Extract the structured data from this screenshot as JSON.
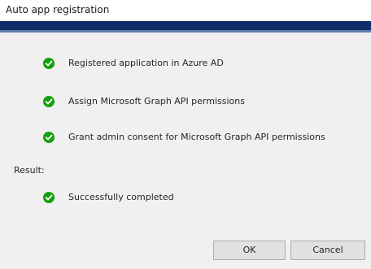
{
  "window": {
    "title": "Auto app registration"
  },
  "steps": [
    {
      "label": "Registered application in Azure AD",
      "status_icon": "check-circle-icon"
    },
    {
      "label": "Assign Microsoft Graph API permissions",
      "status_icon": "check-circle-icon"
    },
    {
      "label": "Grant admin consent for Microsoft Graph API permissions",
      "status_icon": "check-circle-icon"
    }
  ],
  "result": {
    "heading": "Result:",
    "label": "Successfully completed",
    "status_icon": "check-circle-icon"
  },
  "buttons": {
    "ok_label": "OK",
    "cancel_label": "Cancel"
  },
  "colors": {
    "accent": "#0c2d67",
    "success": "#13a10e"
  }
}
